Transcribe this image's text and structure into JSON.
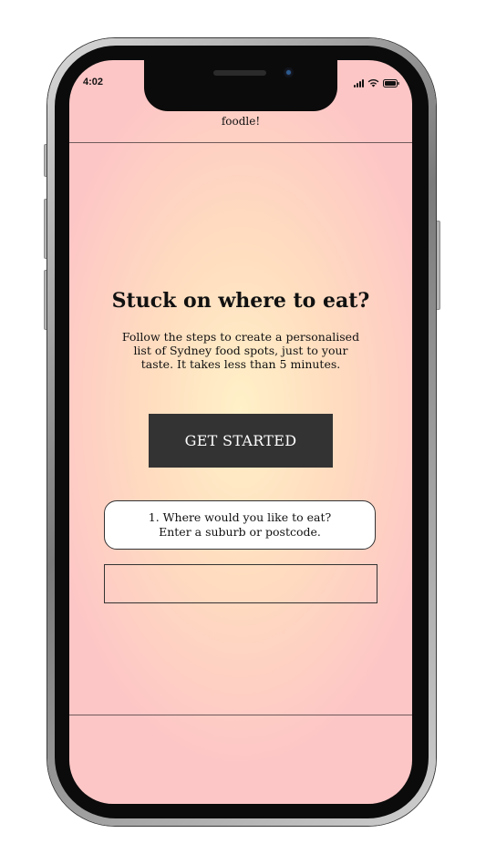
{
  "status_bar": {
    "time": "4:02",
    "icons": [
      "signal-icon",
      "wifi-icon",
      "battery-icon"
    ]
  },
  "header": {
    "app_title": "foodle!"
  },
  "hero": {
    "headline": "Stuck on where to eat?",
    "intro_lines": [
      "Follow the steps to create a personalised",
      "list of Sydney food spots, just to your",
      "taste. It takes less than 5 minutes."
    ],
    "cta_label": "GET STARTED"
  },
  "step1": {
    "question_lines": [
      "1. Where would you like to eat?",
      "Enter a suburb or postcode."
    ],
    "input_value": ""
  },
  "colors": {
    "screen_edge": "#fdc6c6",
    "screen_center": "#fff1c8",
    "button_bg": "#333333",
    "button_text": "#ffffff"
  }
}
